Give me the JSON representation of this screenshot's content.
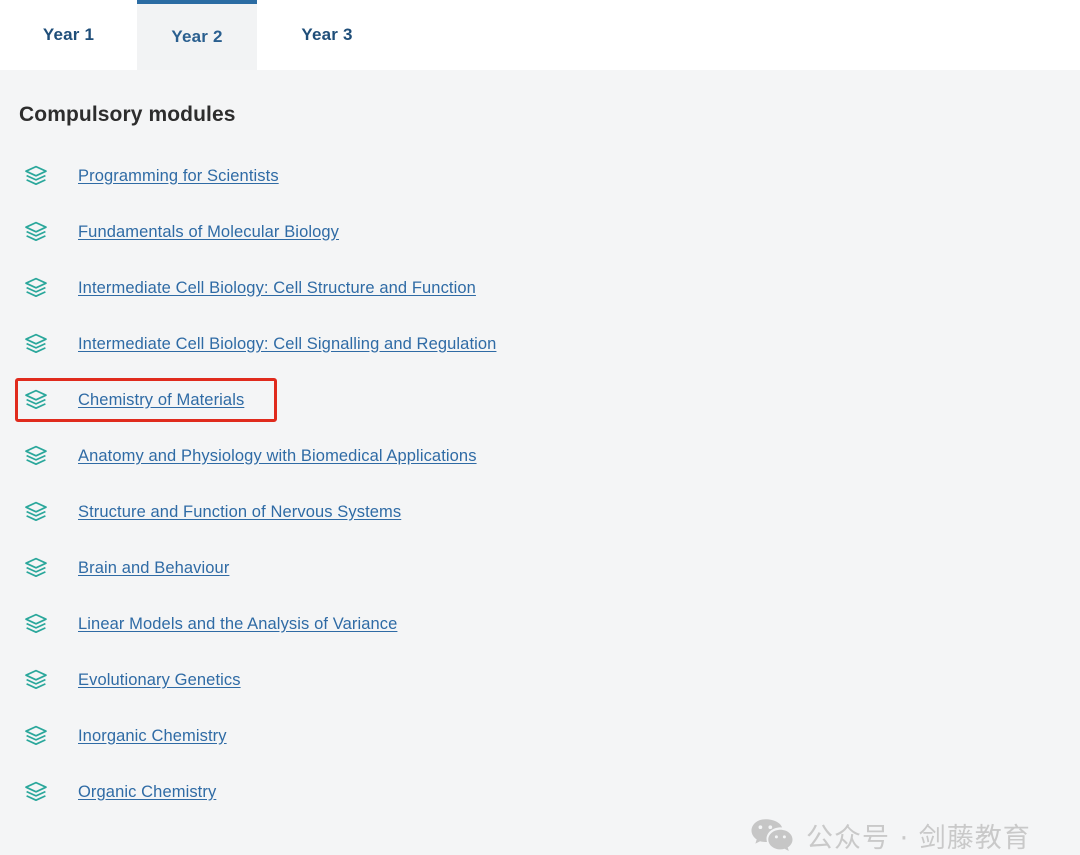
{
  "tabs": [
    {
      "label": "Year 1",
      "active": false
    },
    {
      "label": "Year 2",
      "active": true
    },
    {
      "label": "Year 3",
      "active": false
    }
  ],
  "panel": {
    "heading": "Compulsory modules",
    "modules": [
      {
        "label": "Programming for Scientists",
        "icon": "stack-icon",
        "highlighted": false
      },
      {
        "label": "Fundamentals of Molecular Biology",
        "icon": "stack-icon",
        "highlighted": false
      },
      {
        "label": "Intermediate Cell Biology: Cell Structure and Function",
        "icon": "stack-icon",
        "highlighted": false
      },
      {
        "label": "Intermediate Cell Biology: Cell Signalling and Regulation",
        "icon": "stack-icon",
        "highlighted": false
      },
      {
        "label": "Chemistry of Materials",
        "icon": "stack-icon",
        "highlighted": true
      },
      {
        "label": "Anatomy and Physiology with Biomedical Applications",
        "icon": "stack-icon",
        "highlighted": false
      },
      {
        "label": "Structure and Function of Nervous Systems",
        "icon": "stack-icon",
        "highlighted": false
      },
      {
        "label": "Brain and Behaviour",
        "icon": "stack-icon",
        "highlighted": false
      },
      {
        "label": "Linear Models and the Analysis of Variance",
        "icon": "stack-icon",
        "highlighted": false
      },
      {
        "label": "Evolutionary Genetics",
        "icon": "stack-icon",
        "highlighted": false
      },
      {
        "label": "Inorganic Chemistry",
        "icon": "stack-icon",
        "highlighted": false
      },
      {
        "label": "Organic Chemistry",
        "icon": "stack-icon",
        "highlighted": false
      }
    ]
  },
  "watermark": {
    "text": "公众号 · 剑藤教育",
    "icon": "wechat-icon"
  },
  "colors": {
    "tab_text": "#1f4e79",
    "tab_active_border": "#2b6ca3",
    "tab_active_bg": "#f2f3f4",
    "tab_bar_bg": "#ffffff",
    "panel_bg": "#f4f5f6",
    "heading_text": "#2d2d2d",
    "link": "#2f6ba5",
    "module_icon": "#2aa79b",
    "annotation_border": "#e02b1d",
    "watermark_text": "#c9c9c9"
  }
}
